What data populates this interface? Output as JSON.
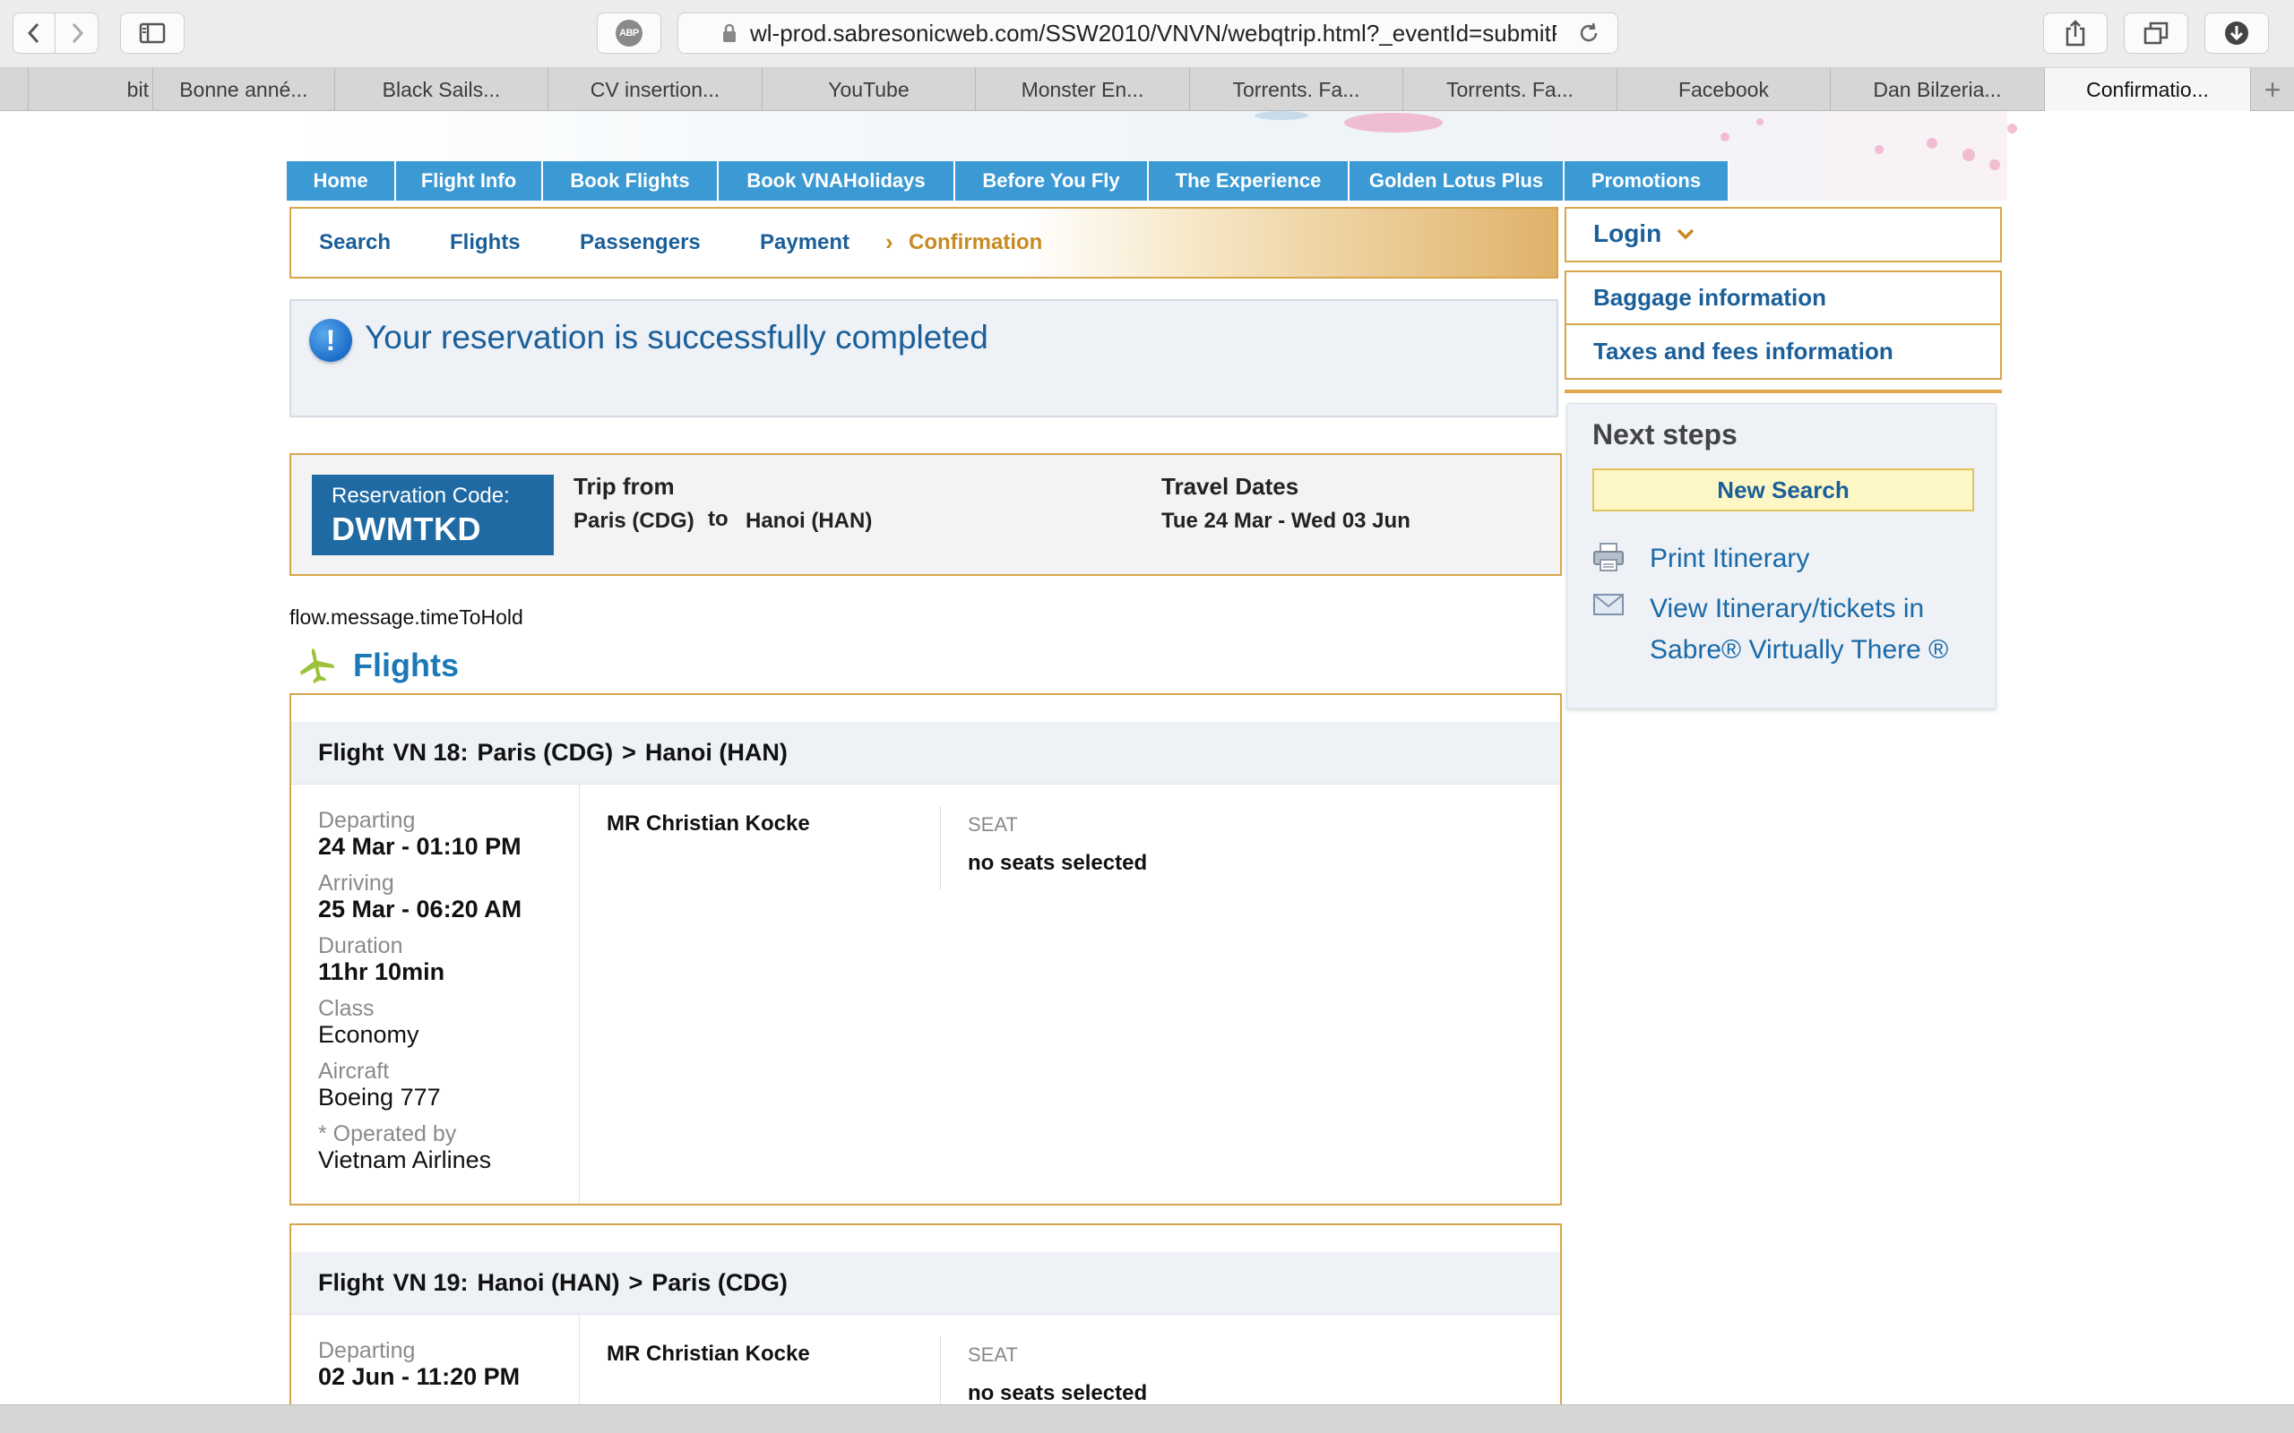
{
  "browser": {
    "url": "wl-prod.sabresonicweb.com/SSW2010/VNVN/webqtrip.html?_eventId=submitPa",
    "adblock_label": "ABP",
    "tabs": [
      {
        "label": ""
      },
      {
        "label": "bit"
      },
      {
        "label": "Bonne anné..."
      },
      {
        "label": "Black Sails..."
      },
      {
        "label": "CV insertion..."
      },
      {
        "label": "YouTube"
      },
      {
        "label": "Monster En..."
      },
      {
        "label": "Torrents. Fa..."
      },
      {
        "label": "Torrents. Fa..."
      },
      {
        "label": "Facebook"
      },
      {
        "label": "Dan Bilzeria..."
      },
      {
        "label": "Confirmatio..."
      }
    ],
    "new_tab": "+"
  },
  "main_nav": [
    "Home",
    "Flight Info",
    "Book Flights",
    "Book VNAHolidays",
    "Before You Fly",
    "The Experience",
    "Golden Lotus Plus",
    "Promotions"
  ],
  "progress_steps": [
    "Search",
    "Flights",
    "Passengers",
    "Payment",
    "Confirmation"
  ],
  "message": "Your reservation is successfully completed",
  "reservation": {
    "code_label": "Reservation Code:",
    "code": "DWMTKD",
    "trip_from_label": "Trip from",
    "origin": "Paris (CDG)",
    "to_label": "to",
    "destination": "Hanoi (HAN)",
    "travel_dates_label": "Travel Dates",
    "travel_dates": "Tue 24 Mar - Wed 03 Jun"
  },
  "hold_message": "flow.message.timeToHold",
  "flights_heading": "Flights",
  "flights": [
    {
      "flight_label": "Flight",
      "number": "VN 18:",
      "route_from": "Paris (CDG)",
      "arrow": ">",
      "route_to": "Hanoi (HAN)",
      "departing_label": "Departing",
      "departing": "24 Mar - 01:10 PM",
      "arriving_label": "Arriving",
      "arriving": "25 Mar - 06:20 AM",
      "duration_label": "Duration",
      "duration": "11hr 10min",
      "class_label": "Class",
      "class": "Economy",
      "aircraft_label": "Aircraft",
      "aircraft": "Boeing 777",
      "operated_label": "* Operated by",
      "operated": "Vietnam Airlines",
      "passenger": "MR Christian Kocke",
      "seat_label": "SEAT",
      "seat": "no seats selected"
    },
    {
      "flight_label": "Flight",
      "number": "VN 19:",
      "route_from": "Hanoi (HAN)",
      "arrow": ">",
      "route_to": "Paris (CDG)",
      "departing_label": "Departing",
      "departing": "02 Jun - 11:20 PM",
      "passenger": "MR Christian Kocke",
      "seat_label": "SEAT",
      "seat": "no seats selected"
    }
  ],
  "sidebar": {
    "login": "Login",
    "baggage": "Baggage information",
    "taxes": "Taxes and fees information",
    "next_steps_title": "Next steps",
    "new_search": "New Search",
    "print_itinerary": "Print Itinerary",
    "view_itinerary": "View Itinerary/tickets in Sabre® Virtually There ®"
  },
  "colors": {
    "nav_blue": "#3b9ad4",
    "link_blue": "#1a5f99",
    "accent_gold": "#d7a54a",
    "reservation_blue": "#1f6aa3"
  }
}
